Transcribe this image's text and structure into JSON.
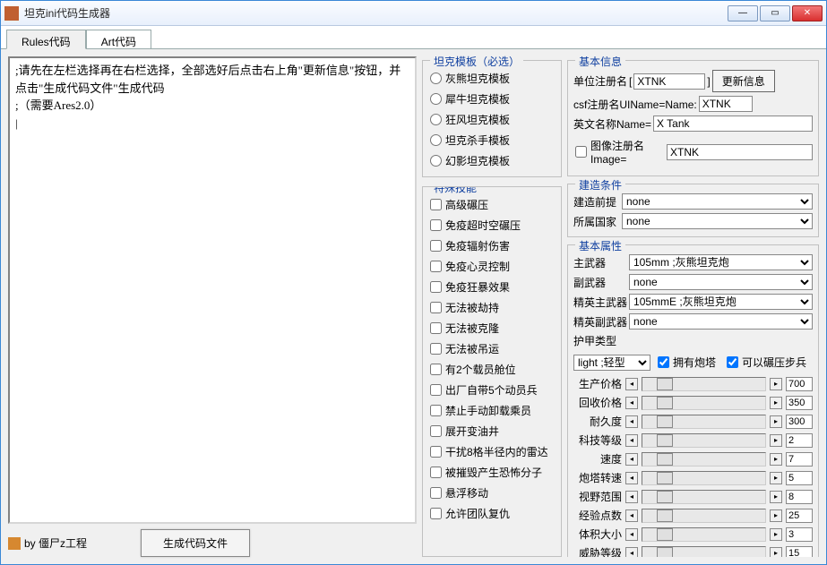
{
  "window": {
    "title": "坦克ini代码生成器"
  },
  "tabs": {
    "rules": "Rules代码",
    "art": "Art代码"
  },
  "editor": {
    "text": ";请先在左栏选择再在右栏选择，全部选好后点击右上角\"更新信息\"按钮，并点击\"生成代码文件\"生成代码\n;（需要Ares2.0）\n|"
  },
  "author": "by 僵尸z工程",
  "gen_button": "生成代码文件",
  "templates": {
    "title": "坦克模板（必选）",
    "items": [
      "灰熊坦克模板",
      "犀牛坦克模板",
      "狂风坦克模板",
      "坦克杀手模板",
      "幻影坦克模板"
    ]
  },
  "skills": {
    "title": "特殊技能",
    "items": [
      "高级碾压",
      "免疫超时空碾压",
      "免疫辐射伤害",
      "免疫心灵控制",
      "免疫狂暴效果",
      "无法被劫持",
      "无法被克隆",
      "无法被吊运",
      "有2个载员舱位",
      "出厂自带5个动员兵",
      "禁止手动卸载乘员",
      "展开变油井",
      "干扰8格半径内的雷达",
      "被摧毁产生恐怖分子",
      "悬浮移动",
      "允许团队复仇"
    ]
  },
  "basic": {
    "title": "基本信息",
    "reg_label": "单位注册名",
    "reg_value": "XTNK",
    "update": "更新信息",
    "csf_label": "csf注册名UIName=Name:",
    "csf_value": "XTNK",
    "en_label": "英文名称Name=",
    "en_value": "X Tank",
    "img_check": "图像注册名  Image=",
    "img_value": "XTNK"
  },
  "build": {
    "title": "建造条件",
    "prereq_label": "建造前提",
    "prereq_value": "none",
    "country_label": "所属国家",
    "country_value": "none"
  },
  "attr": {
    "title": "基本属性",
    "main_label": "主武器",
    "main_value": "105mm ;灰熊坦克炮",
    "sec_label": "副武器",
    "sec_value": "none",
    "elite_main_label": "精英主武器",
    "elite_main_value": "105mmE ;灰熊坦克炮",
    "elite_sec_label": "精英副武器",
    "elite_sec_value": "none",
    "armor_label": "护甲类型",
    "armor_value": "light ;轻型",
    "turret_check": "拥有炮塔",
    "crush_check": "可以碾压步兵",
    "sliders": [
      {
        "label": "生产价格",
        "value": "700"
      },
      {
        "label": "回收价格",
        "value": "350"
      },
      {
        "label": "耐久度",
        "value": "300"
      },
      {
        "label": "科技等级",
        "value": "2"
      },
      {
        "label": "速度",
        "value": "7"
      },
      {
        "label": "炮塔转速",
        "value": "5"
      },
      {
        "label": "视野范围",
        "value": "8"
      },
      {
        "label": "经验点数",
        "value": "25"
      },
      {
        "label": "体积大小",
        "value": "3"
      },
      {
        "label": "威胁等级",
        "value": "15"
      }
    ]
  }
}
